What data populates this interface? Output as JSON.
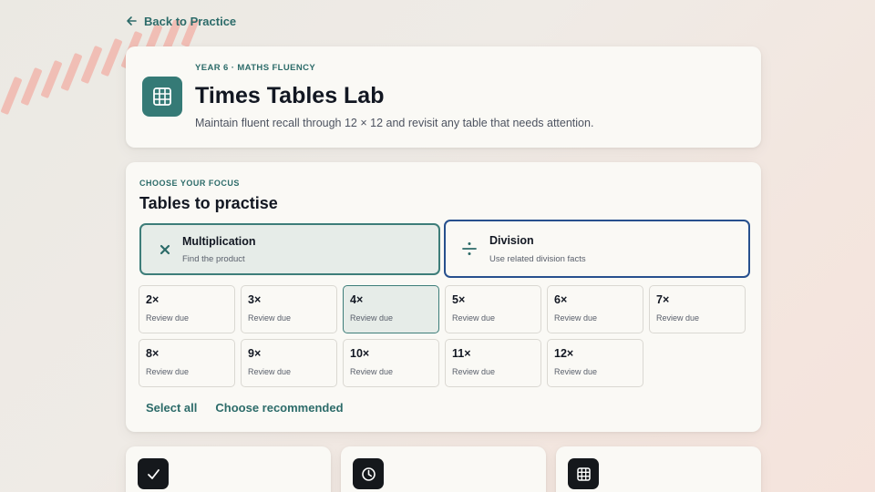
{
  "nav": {
    "back_label": "Back to Practice"
  },
  "hero": {
    "eyebrow": "YEAR 6 · MATHS FLUENCY",
    "title": "Times Tables Lab",
    "subtitle": "Maintain fluent recall through 12 × 12 and revisit any table that needs attention.",
    "icon": "grid-icon"
  },
  "focus": {
    "eyebrow": "CHOOSE YOUR FOCUS",
    "heading": "Tables to practise",
    "modes": [
      {
        "label": "Multiplication",
        "sub": "Find the product",
        "icon": "multiply-icon",
        "selected": true
      },
      {
        "label": "Division",
        "sub": "Use related division facts",
        "icon": "divide-icon",
        "focused": true
      }
    ],
    "tables": [
      {
        "label": "2×",
        "status": "Review due"
      },
      {
        "label": "3×",
        "status": "Review due"
      },
      {
        "label": "4×",
        "status": "Review due",
        "selected": true
      },
      {
        "label": "5×",
        "status": "Review due"
      },
      {
        "label": "6×",
        "status": "Review due"
      },
      {
        "label": "7×",
        "status": "Review due"
      },
      {
        "label": "8×",
        "status": "Review due"
      },
      {
        "label": "9×",
        "status": "Review due"
      },
      {
        "label": "10×",
        "status": "Review due"
      },
      {
        "label": "11×",
        "status": "Review due"
      },
      {
        "label": "12×",
        "status": "Review due"
      }
    ],
    "select_all": "Select all",
    "choose_recommended": "Choose recommended"
  },
  "bottom_cards": [
    {
      "icon": "check-icon"
    },
    {
      "icon": "clock-icon"
    },
    {
      "icon": "grid-icon"
    }
  ],
  "colors": {
    "accent": "#2c6b69",
    "accent_fill": "#357a76",
    "focus_ring": "#27508e",
    "selected_bg": "#e6ece8"
  }
}
